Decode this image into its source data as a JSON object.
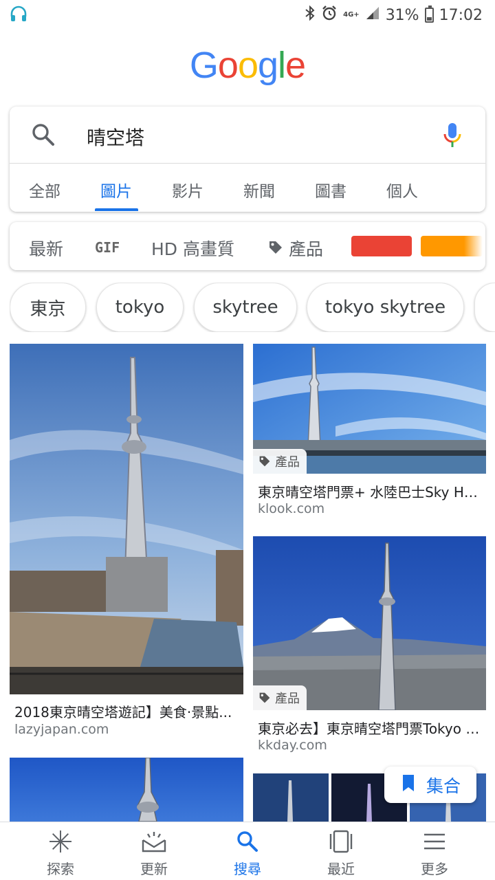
{
  "status_bar": {
    "battery": "31%",
    "time": "17:02",
    "network": "4G+"
  },
  "logo": [
    {
      "ch": "G",
      "color": "#4285F4"
    },
    {
      "ch": "o",
      "color": "#EA4335"
    },
    {
      "ch": "o",
      "color": "#FBBC05"
    },
    {
      "ch": "g",
      "color": "#4285F4"
    },
    {
      "ch": "l",
      "color": "#34A853"
    },
    {
      "ch": "e",
      "color": "#EA4335"
    }
  ],
  "search": {
    "query": "晴空塔"
  },
  "tabs": [
    {
      "label": "全部"
    },
    {
      "label": "圖片"
    },
    {
      "label": "影片"
    },
    {
      "label": "新聞"
    },
    {
      "label": "圖書"
    },
    {
      "label": "個人"
    }
  ],
  "active_tab": "圖片",
  "filters": {
    "latest": "最新",
    "gif": "GIF",
    "hd": "HD 高畫質",
    "products": "產品",
    "color_red": "#EA4335",
    "color_orange": "#FF9800"
  },
  "chips": [
    "東京",
    "tokyo",
    "skytree",
    "tokyo skytree"
  ],
  "results": [
    {
      "title": "2018東京晴空塔遊記】美食‧景點...",
      "source": "lazyjapan.com"
    },
    {
      "title": "東京晴空塔門票+ 水陸巴士Sky Hop Bus",
      "source": "klook.com",
      "badge": "產品"
    },
    {
      "title": "東京必去】東京晴空塔門票Tokyo Skytree",
      "source": "kkday.com",
      "badge": "產品"
    }
  ],
  "collect_button": "集合",
  "bottom_nav": [
    {
      "label": "探索"
    },
    {
      "label": "更新"
    },
    {
      "label": "搜尋"
    },
    {
      "label": "最近"
    },
    {
      "label": "更多"
    }
  ]
}
